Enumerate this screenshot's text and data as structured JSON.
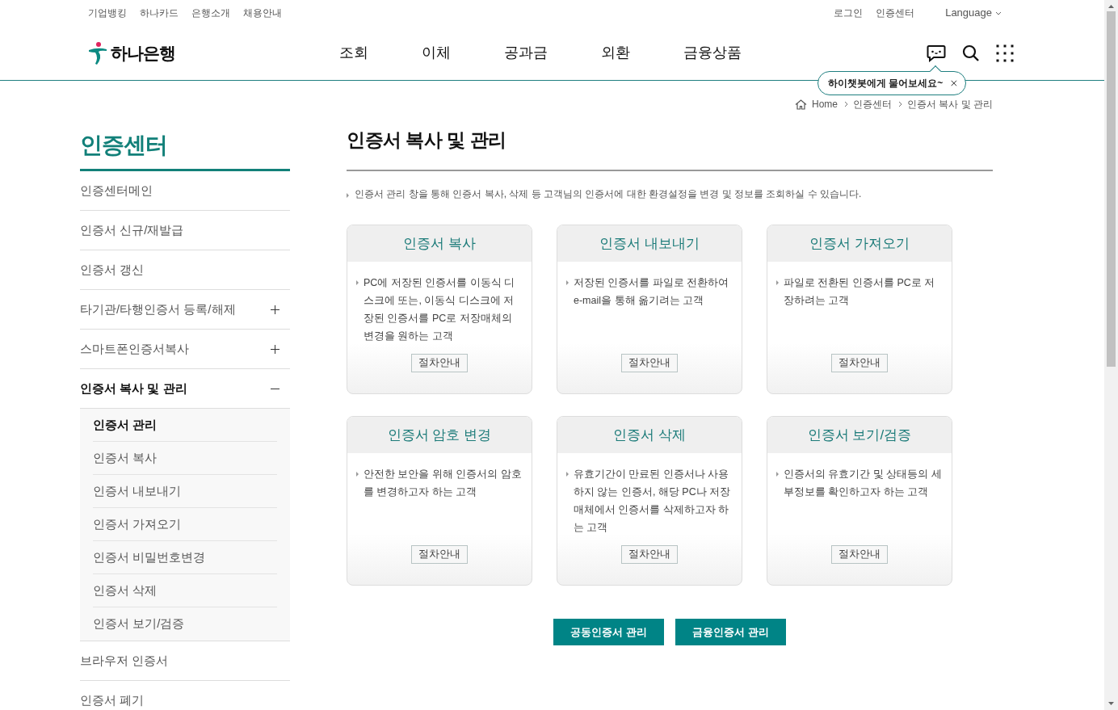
{
  "top_links": [
    "기업뱅킹",
    "하나카드",
    "은행소개",
    "채용안내"
  ],
  "top_right": {
    "links": [
      "로그인",
      "인증센터"
    ],
    "language": "Language"
  },
  "logo": {
    "text": "하나은행"
  },
  "nav": [
    "조회",
    "이체",
    "공과금",
    "외환",
    "금융상품"
  ],
  "chatbot_tip": {
    "text": "하이챗봇에게 물어보세요~"
  },
  "breadcrumb": [
    "Home",
    "인증센터",
    "인증서 복사 및 관리"
  ],
  "sidebar": {
    "title": "인증센터",
    "items": [
      {
        "label": "인증센터메인",
        "kind": "link",
        "selected": false
      },
      {
        "label": "인증서 신규/재발급",
        "kind": "link",
        "selected": false
      },
      {
        "label": "인증서 갱신",
        "kind": "link",
        "selected": false
      },
      {
        "label": "타기관/타행인증서 등록/해제",
        "kind": "group",
        "selected": false,
        "expanded": false
      },
      {
        "label": "스마트폰인증서복사",
        "kind": "group",
        "selected": false,
        "expanded": false
      },
      {
        "label": "인증서 복사 및 관리",
        "kind": "group",
        "selected": true,
        "expanded": true,
        "children": [
          {
            "label": "인증서 관리",
            "selected": true
          },
          {
            "label": "인증서 복사",
            "selected": false
          },
          {
            "label": "인증서 내보내기",
            "selected": false
          },
          {
            "label": "인증서 가져오기",
            "selected": false
          },
          {
            "label": "인증서 비밀번호변경",
            "selected": false
          },
          {
            "label": "인증서 삭제",
            "selected": false
          },
          {
            "label": "인증서 보기/검증",
            "selected": false
          }
        ]
      },
      {
        "label": "브라우저 인증서",
        "kind": "link",
        "selected": false
      },
      {
        "label": "인증서 폐기",
        "kind": "link",
        "selected": false
      }
    ]
  },
  "main": {
    "title": "인증서 복사 및 관리",
    "description": "인증서 관리 창을 통해 인증서 복사, 삭제 등 고객님의 인증서에 대한 환경설정을 변경 및 정보를 조회하실 수 있습니다.",
    "cards": [
      {
        "title": "인증서 복사",
        "text": "PC에 저장된 인증서를 이동식 디스크에 또는, 이동식 디스크에 저장된 인증서를 PC로 저장매체의 변경을 원하는 고객",
        "button": "절차안내"
      },
      {
        "title": "인증서 내보내기",
        "text": "저장된 인증서를 파일로 전환하여 e-mail을 통해 옮기려는 고객",
        "button": "절차안내"
      },
      {
        "title": "인증서 가져오기",
        "text": "파일로 전환된 인증서를 PC로 저장하려는 고객",
        "button": "절차안내"
      },
      {
        "title": "인증서 암호 변경",
        "text": "안전한 보안을 위해 인증서의 암호를 변경하고자 하는 고객",
        "button": "절차안내"
      },
      {
        "title": "인증서 삭제",
        "text": "유효기간이 만료된 인증서나 사용하지 않는 인증서, 해당 PC나 저장매체에서 인증서를 삭제하고자 하는 고객",
        "button": "절차안내"
      },
      {
        "title": "인증서 보기/검증",
        "text": "인증서의 유효기간 및 상태등의 세부정보를 확인하고자 하는 고객",
        "button": "절차안내"
      }
    ],
    "buttons": [
      "공동인증서 관리",
      "금융인증서 관리"
    ]
  }
}
